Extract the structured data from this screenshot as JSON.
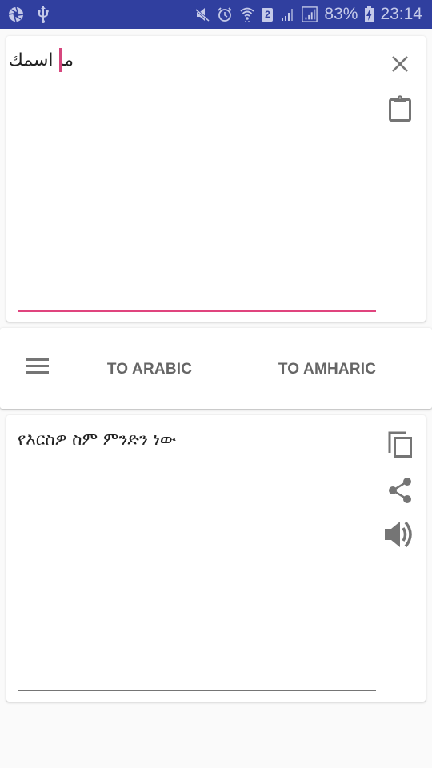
{
  "status_bar": {
    "left_icons": [
      "aperture-icon",
      "usb-icon"
    ],
    "right_icons": [
      "mute-icon",
      "alarm-icon",
      "wifi-icon",
      "sim2-icon",
      "signal-icon",
      "signal-boxed-icon",
      "battery-charging-icon"
    ],
    "sim_slot": "2",
    "battery_percent": "83%",
    "time": "23:14",
    "background_color": "#303f9f"
  },
  "input_card": {
    "text": "ما اسمك",
    "accent_color": "#e0447e",
    "actions": [
      {
        "name": "clear",
        "icon": "close-icon"
      },
      {
        "name": "paste",
        "icon": "clipboard-icon"
      }
    ]
  },
  "controls": {
    "menu_icon": "hamburger-menu-icon",
    "to_arabic_label": "TO ARABIC",
    "to_amharic_label": "TO AMHARIC"
  },
  "output_card": {
    "text": "የእርስዎ ስም ምንድን ነው",
    "actions": [
      {
        "name": "copy",
        "icon": "copy-icon"
      },
      {
        "name": "share",
        "icon": "share-icon"
      },
      {
        "name": "speak",
        "icon": "volume-icon"
      }
    ]
  }
}
